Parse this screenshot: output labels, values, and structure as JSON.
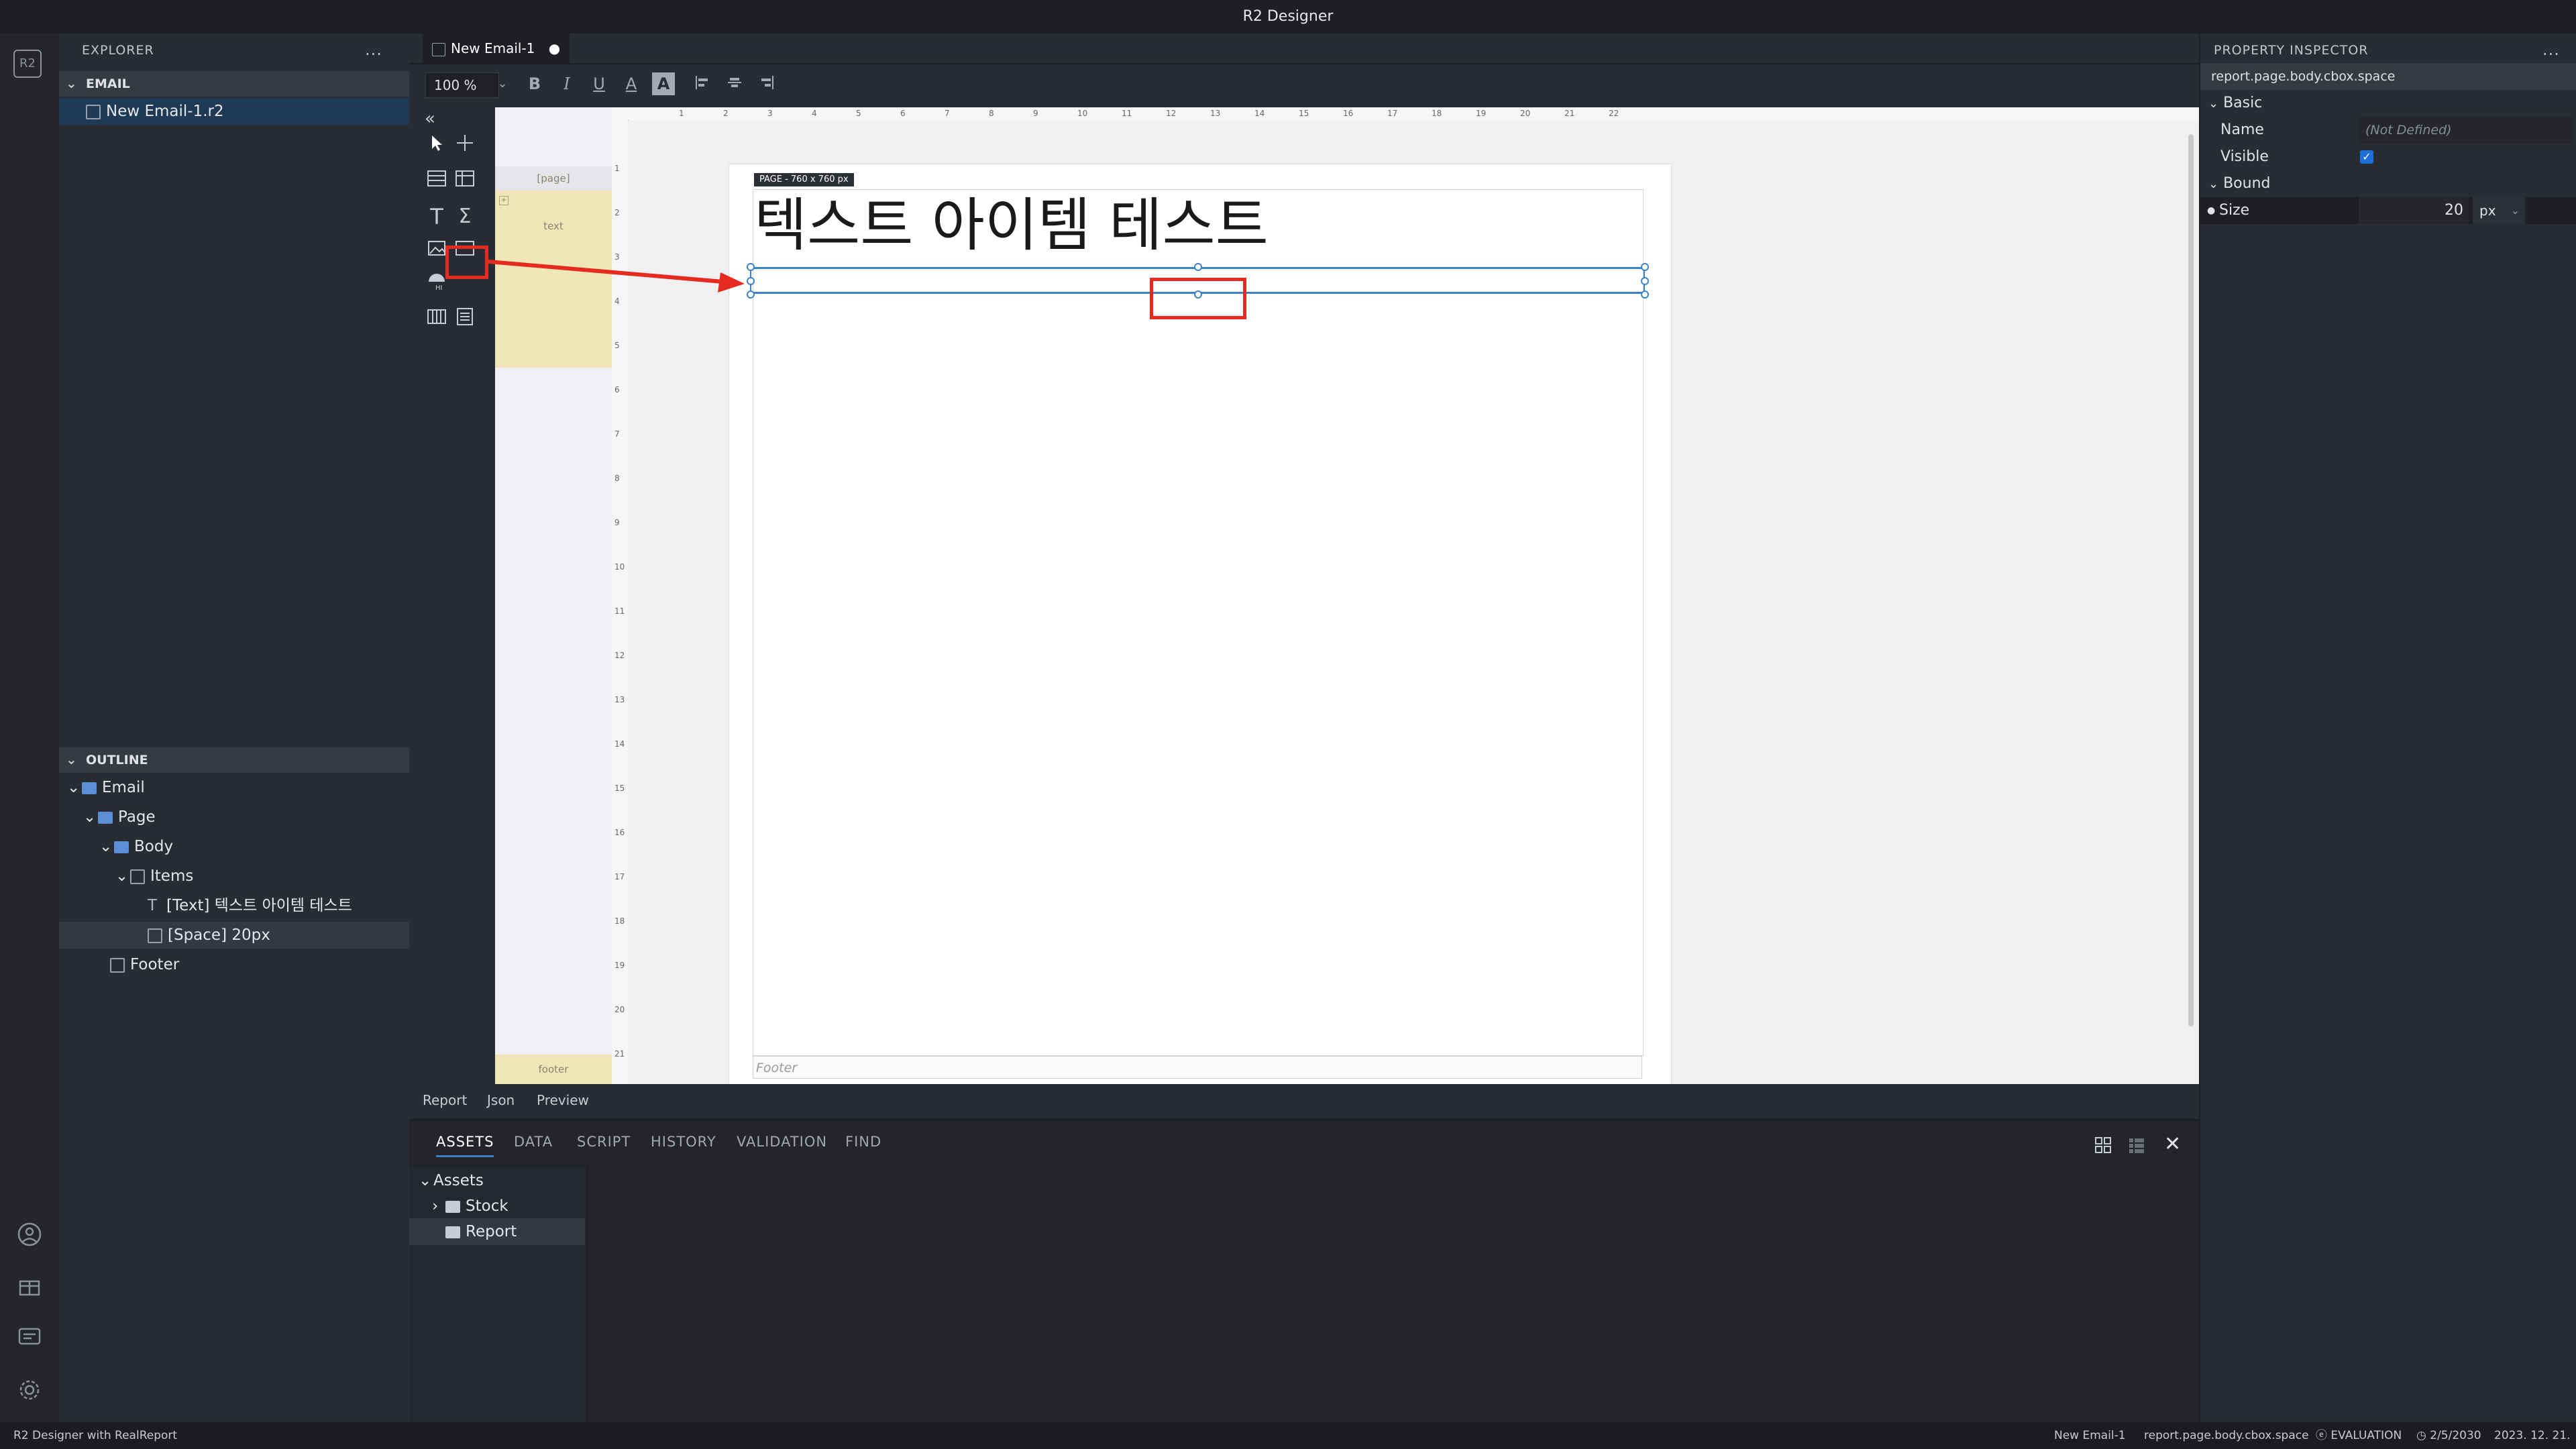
{
  "app": {
    "title": "R2 Designer",
    "logo": "R2"
  },
  "explorer": {
    "title": "EXPLORER",
    "more": "...",
    "section": "EMAIL",
    "file": "New Email-1.r2"
  },
  "outline": {
    "title": "OUTLINE",
    "items": [
      {
        "label": "Email"
      },
      {
        "label": "Page"
      },
      {
        "label": "Body"
      },
      {
        "label": "Items"
      },
      {
        "label": "[Text] 텍스트 아이템 테스트"
      },
      {
        "label": "[Space] 20px"
      },
      {
        "label": "Footer"
      }
    ]
  },
  "tabs": {
    "active": "New Email-1",
    "dirty_mark": "●"
  },
  "toolbar": {
    "zoom": "100 %",
    "bold": "B",
    "italic": "I",
    "underline": "U",
    "font_color": "A",
    "back_color": "A"
  },
  "bands": {
    "page": "[page]",
    "text": "text",
    "footer": "footer"
  },
  "ruler": {
    "h": [
      "1",
      "2",
      "3",
      "4",
      "5",
      "6",
      "7",
      "8",
      "9",
      "10",
      "11",
      "12",
      "13",
      "14",
      "15",
      "16",
      "17",
      "18",
      "19",
      "20",
      "21",
      "22"
    ],
    "v": [
      "1",
      "2",
      "3",
      "4",
      "5",
      "6",
      "7",
      "8",
      "9",
      "10",
      "11",
      "12",
      "13",
      "14",
      "15",
      "16",
      "17",
      "18",
      "19",
      "20",
      "21"
    ]
  },
  "page": {
    "badge": "PAGE - 760 x 760 px",
    "title_text": "텍스트 아이템 테스트",
    "footer_placeholder": "Footer"
  },
  "mode_tabs": [
    "Report",
    "Json",
    "Preview"
  ],
  "bottom_tabs": [
    "ASSETS",
    "DATA",
    "SCRIPT",
    "HISTORY",
    "VALIDATION",
    "FIND"
  ],
  "assets": {
    "root": "Assets",
    "children": [
      "Stock",
      "Report"
    ]
  },
  "inspector": {
    "title": "PROPERTY INSPECTOR",
    "more": "...",
    "path": "report.page.body.cbox.space",
    "basic_group": "Basic",
    "name_label": "Name",
    "name_value": "(Not Defined)",
    "visible_label": "Visible",
    "visible_checked": true,
    "bound_group": "Bound",
    "size_label": "Size",
    "size_value": "20",
    "size_unit": "px"
  },
  "status": {
    "left": "R2 Designer with RealReport",
    "doc": "New Email-1",
    "path": "report.page.body.cbox.space",
    "license": "EVALUATION",
    "expiry": "2/5/2030",
    "date": "2023. 12. 21."
  },
  "colors": {
    "accent": "#3a82c8",
    "annotation": "#e52b1f",
    "band": "#f1e6b8"
  }
}
